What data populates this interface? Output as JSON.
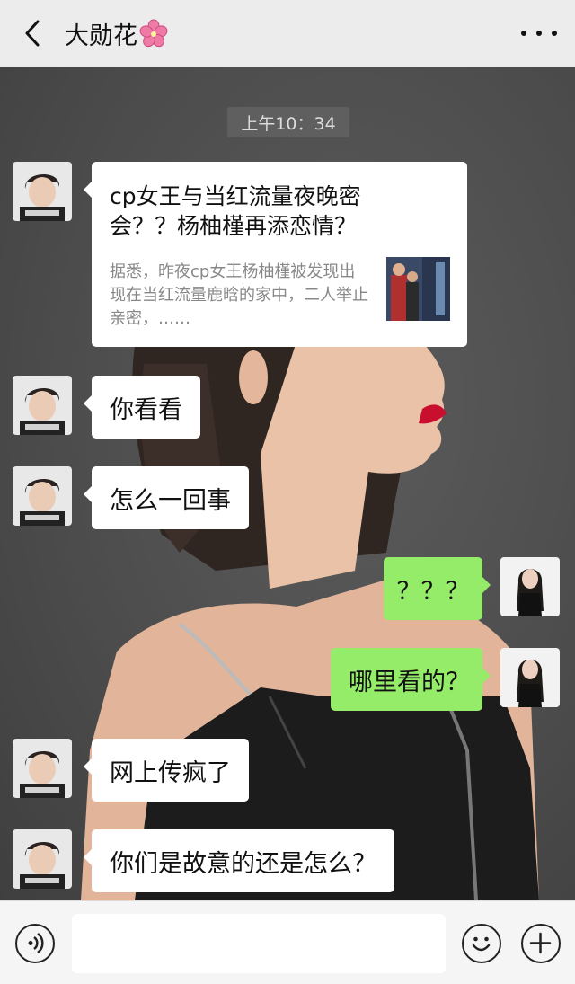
{
  "header": {
    "back_icon": "chevron-left-icon",
    "title": "大勋花",
    "title_emoji": "cherry-blossom-icon",
    "more_icon": "more-dots-icon"
  },
  "chat": {
    "timestamp": "上午10：34",
    "shared_article": {
      "title": "cp女王与当红流量夜晚密会？？杨柚槿再添恋情？",
      "description": "据悉，昨夜cp女王杨柚槿被发现出现在当红流量鹿晗的家中，二人举止亲密，……"
    },
    "messages": [
      {
        "side": "left",
        "text": "你看看"
      },
      {
        "side": "left",
        "text": "怎么一回事"
      },
      {
        "side": "right",
        "text": "？？？"
      },
      {
        "side": "right",
        "text": "哪里看的？"
      },
      {
        "side": "left",
        "text": "网上传疯了"
      },
      {
        "side": "left",
        "text": "你们是故意的还是怎么？"
      }
    ],
    "colors": {
      "sent_bubble": "#95ec69",
      "received_bubble": "#ffffff",
      "header_bg": "#ececec"
    }
  },
  "inputbar": {
    "voice_icon": "voice-icon",
    "input_value": "",
    "emoji_icon": "emoji-icon",
    "plus_icon": "plus-icon"
  }
}
